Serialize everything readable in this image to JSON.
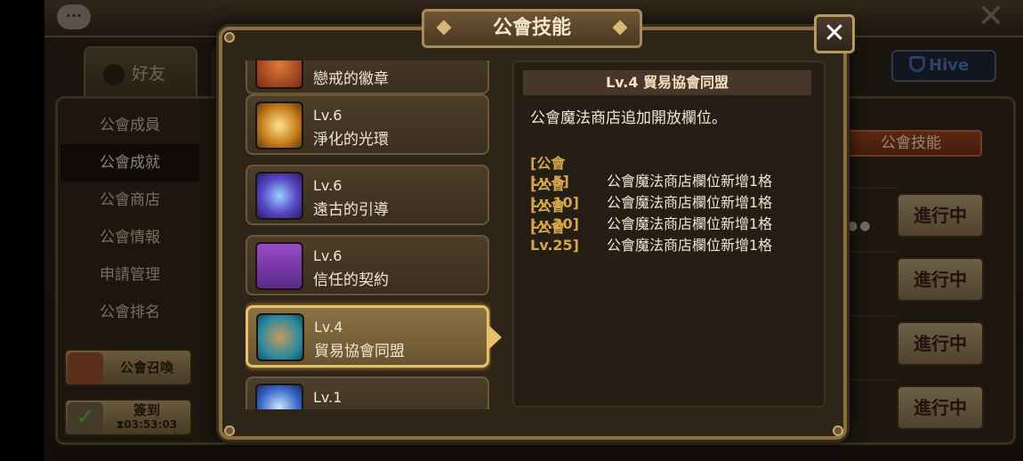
{
  "background": {
    "topbar_title": "",
    "friend_tab": "好友",
    "hive_label": "Hive",
    "left_menu": [
      "公會成員",
      "公會成就",
      "公會商店",
      "公會情報",
      "申請管理",
      "公會排名"
    ],
    "active_menu_index": 1,
    "summon_label": "公會召喚",
    "checkin_label": "簽到",
    "checkin_timer": "03:53:03",
    "guild_skill_tab": "公會技能",
    "progress_labels": [
      "進行中",
      "進行中",
      "進行中",
      "進行中"
    ]
  },
  "modal": {
    "title": "公會技能",
    "close_glyph": "✕",
    "skills": [
      {
        "level": "",
        "name": "戀戒的徽章",
        "icon": "badge-icon",
        "color": "#b0502a"
      },
      {
        "level": "Lv.6",
        "name": "淨化的光環",
        "icon": "halo-icon",
        "color": "#d89a2a"
      },
      {
        "level": "Lv.6",
        "name": "遠古的引導",
        "icon": "ancient-rune-icon",
        "color": "#5a48c8"
      },
      {
        "level": "Lv.6",
        "name": "信任的契約",
        "icon": "contract-icon",
        "color": "#7a3aa8"
      },
      {
        "level": "Lv.4",
        "name": "貿易協會同盟",
        "icon": "trade-box-icon",
        "color": "#2a8aa0"
      },
      {
        "level": "Lv.1",
        "name": "",
        "icon": "crystal-icon",
        "color": "#3a6ac8"
      }
    ],
    "selected_index": 4,
    "detail": {
      "title": "Lv.4 貿易協會同盟",
      "description": "公會魔法商店追加開放欄位。",
      "bonuses": [
        {
          "tag": "[公會 Lv.5]",
          "text": "公會魔法商店欄位新增1格"
        },
        {
          "tag": "[公會 Lv.10]",
          "text": "公會魔法商店欄位新增1格"
        },
        {
          "tag": "[公會 Lv.20]",
          "text": "公會魔法商店欄位新增1格"
        },
        {
          "tag": "[公會 Lv.25]",
          "text": "公會魔法商店欄位新增1格"
        }
      ]
    }
  }
}
